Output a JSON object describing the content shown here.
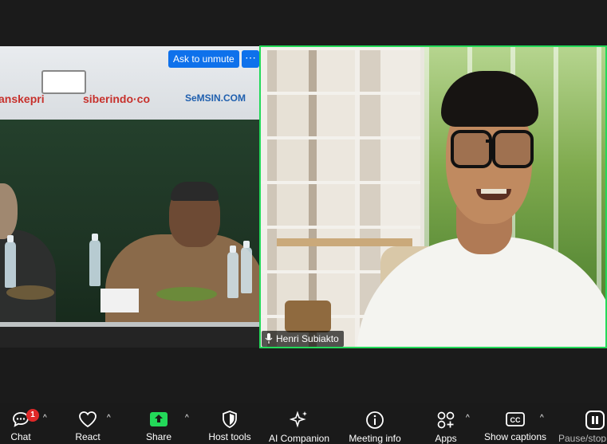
{
  "tiles": {
    "left": {
      "unmute_label": "Ask to unmute",
      "more_label": "⋯",
      "banner": [
        "anskepri",
        "siberindo·co",
        "SeMSIN.COM"
      ]
    },
    "right": {
      "participant_name": "Henri Subiakto"
    }
  },
  "toolbar": {
    "items": [
      {
        "label": "Chat",
        "icon": "chat-icon"
      },
      {
        "label": "React",
        "icon": "heart-icon"
      },
      {
        "label": "Share",
        "icon": "share-icon"
      },
      {
        "label": "Host tools",
        "icon": "shield-icon"
      },
      {
        "label": "AI Companion",
        "icon": "sparkle-icon"
      },
      {
        "label": "Meeting info",
        "icon": "info-icon"
      },
      {
        "label": "Apps",
        "icon": "apps-icon"
      },
      {
        "label": "Show captions",
        "icon": "cc-icon"
      },
      {
        "label": "Pause/stop",
        "icon": "pause-icon"
      }
    ],
    "chat_badge": "1",
    "accent": "#23d959",
    "share_color": "#23d959"
  }
}
